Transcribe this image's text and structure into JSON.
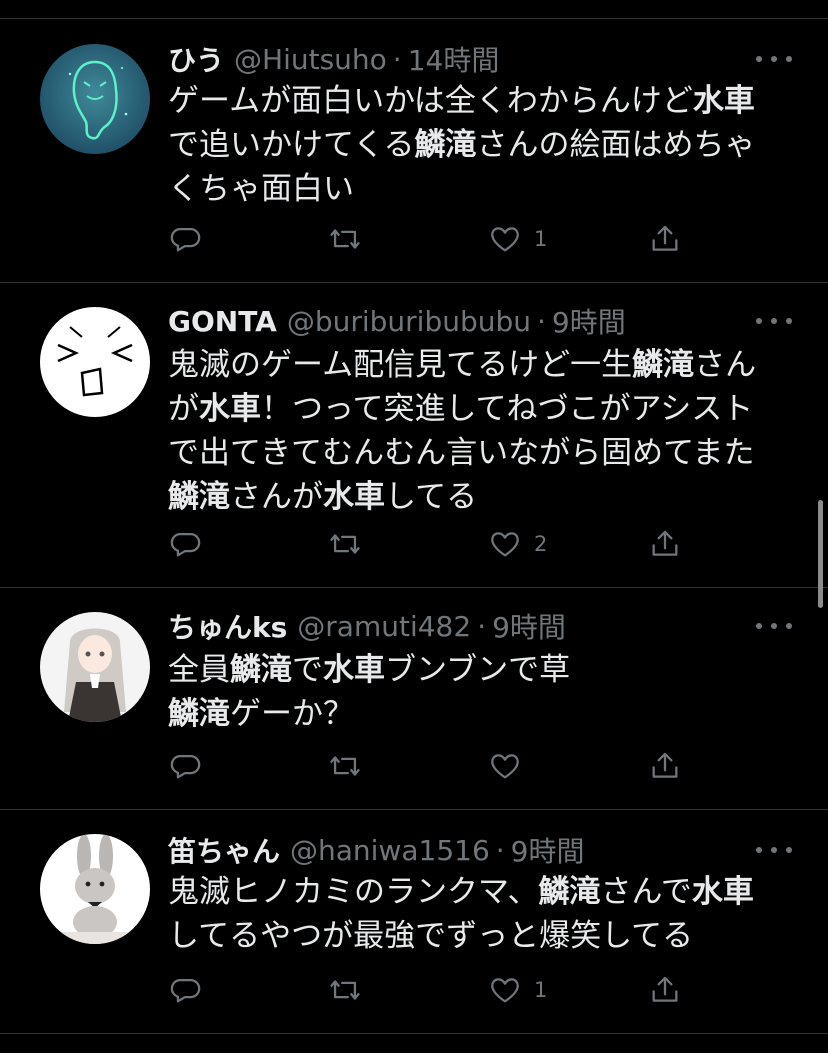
{
  "tweets": [
    {
      "name": "ひう",
      "handle": "@Hiutsuho",
      "time": "14時間",
      "lines": [
        [
          {
            "t": "ゲームが面白いかは全くわからんけど"
          },
          {
            "t": "水車",
            "b": true
          }
        ],
        [
          {
            "t": "で追いかけてくる"
          },
          {
            "t": "鱗滝",
            "b": true
          },
          {
            "t": "さんの絵面はめちゃ"
          }
        ],
        [
          {
            "t": "くちゃ面白い"
          }
        ]
      ],
      "likes": "1",
      "avatar": "ghost-avatar"
    },
    {
      "name": "GONTA",
      "handle": "@buriburibububu",
      "time": "9時間",
      "lines": [
        [
          {
            "t": "鬼滅のゲーム配信見てるけど一生"
          },
          {
            "t": "鱗滝",
            "b": true
          },
          {
            "t": "さん"
          }
        ],
        [
          {
            "t": "が"
          },
          {
            "t": "水車",
            "b": true
          },
          {
            "t": "！つって突進してねづこがアシスト"
          }
        ],
        [
          {
            "t": "で出てきてむんむん言いながら固めてまた"
          }
        ],
        [
          {
            "t": "鱗滝",
            "b": true
          },
          {
            "t": "さんが"
          },
          {
            "t": "水車",
            "b": true
          },
          {
            "t": "してる"
          }
        ]
      ],
      "likes": "2",
      "avatar": "face-sketch-avatar"
    },
    {
      "name": "ちゅんks",
      "handle": "@ramuti482",
      "time": "9時間",
      "lines": [
        [
          {
            "t": "全員"
          },
          {
            "t": "鱗滝",
            "b": true
          },
          {
            "t": "で"
          },
          {
            "t": "水車",
            "b": true
          },
          {
            "t": "ブンブンで草"
          }
        ],
        [
          {
            "t": "鱗滝",
            "b": true
          },
          {
            "t": "ゲーか？"
          }
        ]
      ],
      "likes": "",
      "avatar": "anime-girl-avatar"
    },
    {
      "name": "笛ちゃん",
      "handle": "@haniwa1516",
      "time": "9時間",
      "lines": [
        [
          {
            "t": "鬼滅ヒノカミのランクマ、"
          },
          {
            "t": "鱗滝",
            "b": true
          },
          {
            "t": "さんで"
          },
          {
            "t": "水車",
            "b": true
          }
        ],
        [
          {
            "t": "してるやつが最強でずっと爆笑してる"
          }
        ]
      ],
      "likes": "1",
      "avatar": "rabbit-avatar"
    }
  ],
  "dot_separator": "·",
  "colors": {
    "background": "#000000",
    "text": "#e7e9ea",
    "muted": "#71767b",
    "divider": "#2f3336"
  }
}
